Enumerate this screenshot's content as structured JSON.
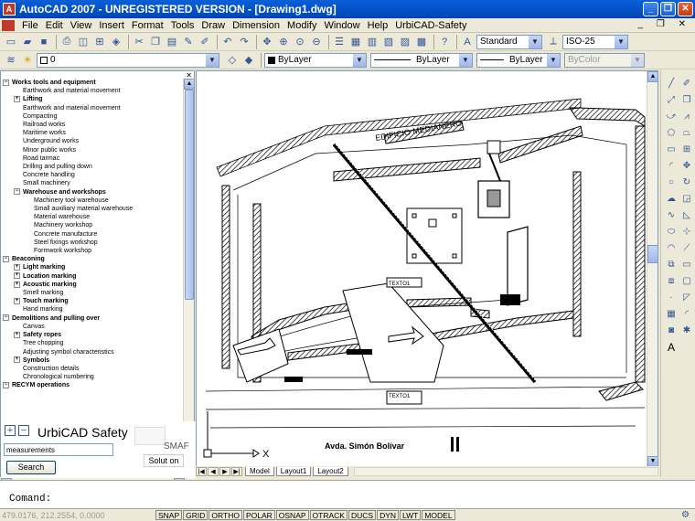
{
  "window": {
    "title": "AutoCAD 2007 - UNREGISTERED VERSION - [Drawing1.dwg]",
    "minimize": "_",
    "maximize": "❐",
    "close": "✕"
  },
  "menu": {
    "items": [
      "File",
      "Edit",
      "View",
      "Insert",
      "Format",
      "Tools",
      "Draw",
      "Dimension",
      "Modify",
      "Window",
      "Help",
      "UrbiCAD-Safety"
    ],
    "doc_controls": "_ ❐ ✕"
  },
  "toolbar1": {
    "text_style": "Standard",
    "dim_style": "ISO-25"
  },
  "toolbar2": {
    "layer": "0",
    "color": "ByLayer",
    "linetype": "ByLayer",
    "lineweight": "ByLayer",
    "plot_style": "ByColor"
  },
  "tree": {
    "items": [
      {
        "level": 0,
        "expander": "−",
        "label": "Works tools and equipment",
        "bold": true
      },
      {
        "level": 1,
        "label": "Earthwork and material movement"
      },
      {
        "level": 1,
        "expander": "+",
        "label": "Lifting",
        "bold": true
      },
      {
        "level": 1,
        "label": "Earthwork and material movement"
      },
      {
        "level": 1,
        "label": "Compacting"
      },
      {
        "level": 1,
        "label": "Railroad works"
      },
      {
        "level": 1,
        "label": "Maritime works"
      },
      {
        "level": 1,
        "label": "Underground works"
      },
      {
        "level": 1,
        "label": "Minor public works"
      },
      {
        "level": 1,
        "label": "Road tarmac"
      },
      {
        "level": 1,
        "label": "Drilling and pulling down"
      },
      {
        "level": 1,
        "label": "Concrete handling"
      },
      {
        "level": 1,
        "label": "Small machinery"
      },
      {
        "level": 1,
        "expander": "−",
        "label": "Warehouse and workshops",
        "bold": true
      },
      {
        "level": 2,
        "label": "Machinery tool warehouse"
      },
      {
        "level": 2,
        "label": "Small auxiliary material warehouse"
      },
      {
        "level": 2,
        "label": "Material warehouse"
      },
      {
        "level": 2,
        "label": "Machinery workshop"
      },
      {
        "level": 2,
        "label": "Concrete manufacture"
      },
      {
        "level": 2,
        "label": "Steel fixings workshop"
      },
      {
        "level": 2,
        "label": "Formwork workshop"
      },
      {
        "level": 0,
        "expander": "−",
        "label": "Beaconing",
        "bold": true
      },
      {
        "level": 1,
        "expander": "+",
        "label": "Light marking",
        "bold": true
      },
      {
        "level": 1,
        "expander": "+",
        "label": "Location marking",
        "bold": true
      },
      {
        "level": 1,
        "expander": "+",
        "label": "Acoustic marking",
        "bold": true
      },
      {
        "level": 1,
        "label": "Smell marking"
      },
      {
        "level": 1,
        "expander": "+",
        "label": "Touch marking",
        "bold": true
      },
      {
        "level": 1,
        "label": "Hand marking"
      },
      {
        "level": 0,
        "expander": "−",
        "label": "Demolitions and pulling over",
        "bold": true
      },
      {
        "level": 1,
        "label": "Canvas"
      },
      {
        "level": 1,
        "expander": "+",
        "label": "Safety ropes",
        "bold": true
      },
      {
        "level": 1,
        "label": "Tree chopping"
      },
      {
        "level": 1,
        "label": "Adjusting symbol characteristics"
      },
      {
        "level": 1,
        "expander": "+",
        "label": "Symbols",
        "bold": true
      },
      {
        "level": 1,
        "label": "Construction details"
      },
      {
        "level": 1,
        "label": "Chronological numbering"
      },
      {
        "level": 0,
        "expander": "−",
        "label": "RECYM operations",
        "bold": true
      }
    ]
  },
  "search_panel": {
    "title": "UrbiCAD Safety",
    "input_value": "measurements",
    "search_button": "Search",
    "logo_text_1": "SMAF",
    "logo_text_2": "Solut on"
  },
  "drawing": {
    "building_label": "EDIFICIO MEDIANERO",
    "street_label": "Avda. Simón Bolívar",
    "axis_x": "X",
    "text_labels": [
      "TEXTO1",
      "TEXTO1",
      "TEXTO1",
      "TEXTO1"
    ]
  },
  "layout_tabs": [
    "Model",
    "Layout1",
    "Layout2"
  ],
  "command": {
    "prompt": "Comand:"
  },
  "status": {
    "coords": "479.0176, 212.2554, 0.0000",
    "toggles": [
      "SNAP",
      "GRID",
      "ORTHO",
      "POLAR",
      "OSNAP",
      "OTRACK",
      "DUCS",
      "DYN",
      "LWT",
      "MODEL"
    ]
  }
}
